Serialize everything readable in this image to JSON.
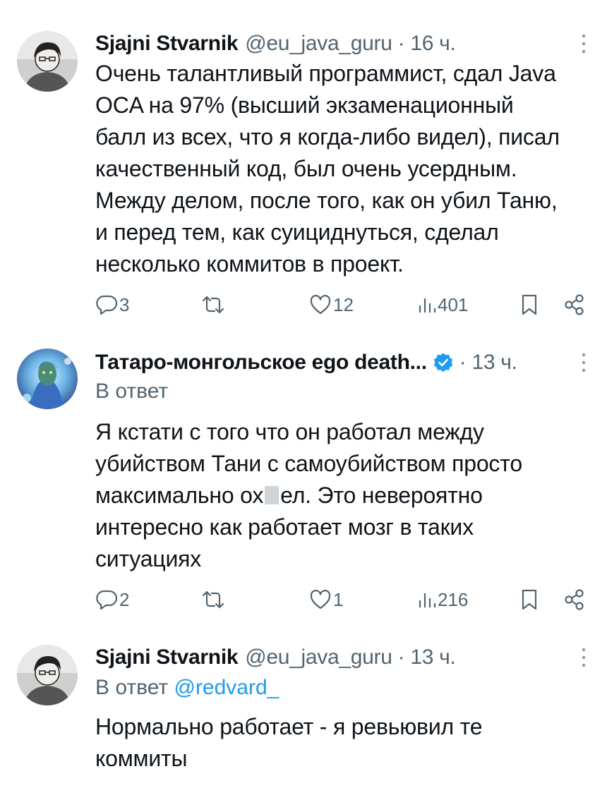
{
  "tweets": [
    {
      "author_name": "Sjajni Stvarnik",
      "handle": "@eu_java_guru",
      "dot": "·",
      "time": "16 ч.",
      "reply_label": "",
      "reply_mention": "",
      "lines": [
        "Очень талантливый программист, сдал Java",
        "OCA на 97% (высший экзаменационный",
        "балл из всех, что я когда-либо видел), писал",
        "качественный код, был очень усердным.",
        "Между делом, после того, как он убил Таню,",
        "и перед тем, как суициднуться, сделал",
        "несколько коммитов в проект."
      ],
      "replies": "3",
      "reposts": "",
      "likes": "12",
      "views": "401"
    },
    {
      "author_name": "Татаро-монгольское ego death...",
      "handle": "",
      "dot": "·",
      "time": "13 ч.",
      "reply_label": "В ответ",
      "reply_mention": "",
      "lines": [
        "Я кстати с того что он работал между",
        "убийством Тани с самоубийством просто",
        "максимально ох",
        "интересно как работает мозг в таких",
        "ситуациях"
      ],
      "censored_line_tail": "ел. Это невероятно",
      "replies": "2",
      "reposts": "",
      "likes": "1",
      "views": "216"
    },
    {
      "author_name": "Sjajni Stvarnik",
      "handle": "@eu_java_guru",
      "dot": "·",
      "time": "13 ч.",
      "reply_label": "В ответ",
      "reply_mention": "@redvard_",
      "lines": [
        "Нормально работает - я ревьювил те",
        "коммиты"
      ]
    }
  ],
  "icons": {
    "reply": "reply-icon",
    "repost": "repost-icon",
    "like": "heart-icon",
    "views": "views-icon",
    "bookmark": "bookmark-icon",
    "share": "share-icon",
    "more": "more-icon",
    "verified": "verified-badge-icon"
  },
  "colors": {
    "text": "#0f1419",
    "secondary": "#536471",
    "accent": "#1d9bf0"
  }
}
